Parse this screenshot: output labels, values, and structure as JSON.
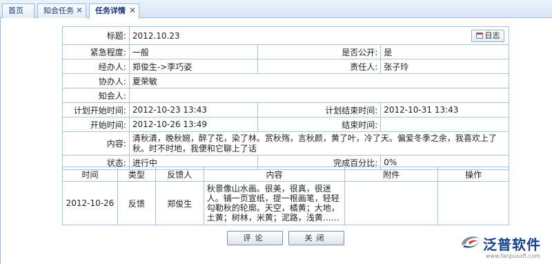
{
  "tabs": [
    {
      "label": "首页"
    },
    {
      "label": "知会任务"
    },
    {
      "label": "任务详情"
    }
  ],
  "detail": {
    "title_label": "标题:",
    "title_value": "2012.10.23",
    "log_button": "日志",
    "urgency_label": "紧急程度:",
    "urgency_value": "一般",
    "public_label": "是否公开:",
    "public_value": "是",
    "handler_label": "经办人:",
    "handler_value": "郑俊生->李巧姿",
    "owner_label": "责任人:",
    "owner_value": "张子玲",
    "assist_label": "协办人:",
    "assist_value": "夏荣敏",
    "notify_label": "知会人:",
    "notify_value": "",
    "plan_start_label": "计划开始时间:",
    "plan_start_value": "2012-10-23 13:43",
    "plan_end_label": "计划结束时间:",
    "plan_end_value": "2012-10-31 13:43",
    "start_label": "开始时间:",
    "start_value": "2012-10-26 13:49",
    "end_label": "结束时间:",
    "end_value": "",
    "content_label": "内容:",
    "content_value": "清秋清，晚秋婉，醉了花，染了林。赏秋殇，言秋颜，黄了叶，冷了天。偏爱冬季之余，我喜欢上了秋。时不时地，我便和它聊上了话",
    "status_label": "状态:",
    "status_value": "进行中",
    "percent_label": "完成百分比:",
    "percent_value": "0%"
  },
  "feedback": {
    "headers": [
      "时间",
      "类型",
      "反馈人",
      "内容",
      "附件",
      "操作"
    ],
    "rows": [
      {
        "time": "2012-10-26",
        "type": "反馈",
        "person": "郑俊生",
        "content": "秋景像山水画。很美，很真，很迷人。铺一页宣纸，提一根画笔，轻轻勾勒秋的轮廓。天空，橘黄；大地，土黄；树林，米黄；泥路，浅黄……",
        "attachment": "",
        "action": ""
      }
    ]
  },
  "buttons": {
    "comment": "评论",
    "close": "关闭"
  },
  "logo": {
    "name": "泛普软件",
    "url": "www.fanpusoft.com"
  },
  "colors": {
    "tab_text": "#16387a",
    "border": "#a5c2dd",
    "logo_blue": "#153f8a"
  }
}
